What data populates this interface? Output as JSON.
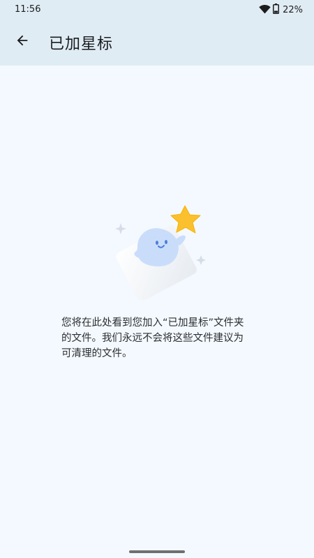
{
  "status_bar": {
    "time": "11:56",
    "battery_percent": "22%",
    "icons": [
      "wifi-icon",
      "battery-icon"
    ]
  },
  "app_bar": {
    "back_icon": "arrow-back-icon",
    "title": "已加星标"
  },
  "empty_state": {
    "illustration": "ghost-holding-star",
    "message": "您将在此处看到您加入“已加星标”文件夹的文件。我们永远不会将这些文件建议为可清理的文件。"
  },
  "colors": {
    "header_bg": "#e0ecf4",
    "page_bg": "#f4f9ff",
    "star": "#fbc02d",
    "ghost": "#c9ddfb"
  }
}
